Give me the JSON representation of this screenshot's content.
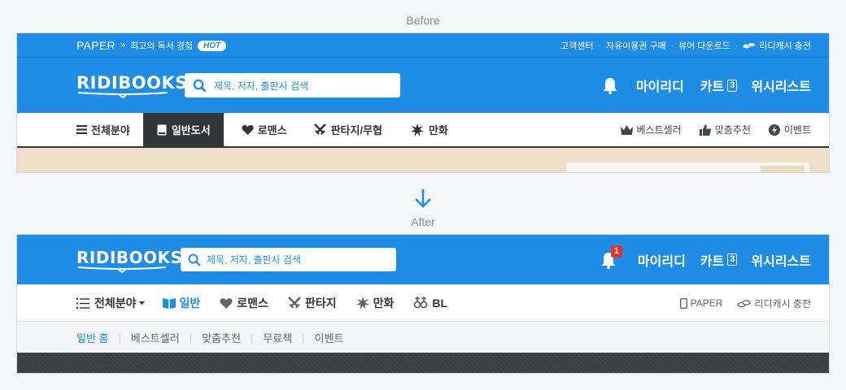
{
  "labels": {
    "before": "Before",
    "after": "After"
  },
  "before": {
    "topbar": {
      "paper": "PAPER",
      "tagline": "최고의 독서 경험",
      "hot_badge": "HOT",
      "links": [
        "고객센터",
        "자유이용권 구매",
        "뷰어 다운로드",
        "리디캐시 충전"
      ]
    },
    "header": {
      "logo": "RIDIBOOKS",
      "search_placeholder": "제목, 저자, 출판사 검색",
      "my_ridi": "마이리디",
      "cart": "카트",
      "cart_count": "3",
      "wishlist": "위시리스트"
    },
    "categories": [
      {
        "label": "전체분야",
        "icon": "hamburger-icon"
      },
      {
        "label": "일반도서",
        "icon": "book-icon",
        "active": true
      },
      {
        "label": "로맨스",
        "icon": "heart-icon"
      },
      {
        "label": "판타지/무협",
        "icon": "crossed-swords-icon"
      },
      {
        "label": "만화",
        "icon": "burst-icon"
      }
    ],
    "right_links": [
      {
        "label": "베스트셀러",
        "icon": "crown-icon"
      },
      {
        "label": "맞춤추천",
        "icon": "thumbs-up-icon"
      },
      {
        "label": "이벤트",
        "icon": "lightning-icon"
      }
    ]
  },
  "after": {
    "header": {
      "logo": "RIDIBOOKS",
      "search_placeholder": "제목, 저자, 출판사 검색",
      "notification_count": "1",
      "my_ridi": "마이리디",
      "cart": "카트",
      "cart_count": "3",
      "wishlist": "위시리스트"
    },
    "categories": [
      {
        "label": "전체분야",
        "icon": "list-icon"
      },
      {
        "label": "일반",
        "icon": "open-book-icon",
        "active": true
      },
      {
        "label": "로맨스",
        "icon": "heart-icon"
      },
      {
        "label": "판타지",
        "icon": "crossed-swords-icon"
      },
      {
        "label": "만화",
        "icon": "burst-icon"
      },
      {
        "label": "BL",
        "icon": "gender-icon"
      }
    ],
    "right_links": [
      {
        "label": "PAPER",
        "icon": "device-icon"
      },
      {
        "label": "리디캐시 충전",
        "icon": "coins-icon"
      }
    ],
    "subnav": [
      "일반 홈",
      "베스트셀러",
      "맞춤추천",
      "무료책",
      "이벤트"
    ]
  },
  "colors": {
    "brand": "#1f8ce6",
    "dark": "#303538",
    "badge_red": "#e6332a",
    "banner_before": "#efdfc9",
    "banner_after": "#3b3d40"
  }
}
